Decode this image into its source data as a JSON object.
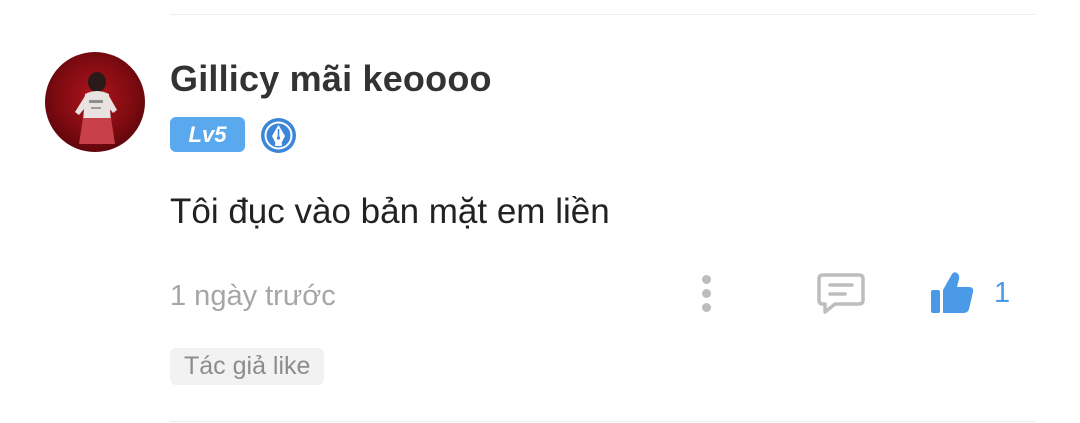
{
  "comment": {
    "username": "Gillicy mãi keoooo",
    "level": "Lv5",
    "text": "Tôi đục vào bản mặt em liền",
    "timestamp": "1 ngày trước",
    "like_count": "1",
    "author_liked_label": "Tác giả like"
  },
  "icons": {
    "avatar": "user-avatar",
    "level_badge": "level-badge",
    "creator_badge": "pen-nib-badge-icon",
    "more": "more-vertical-icon",
    "reply": "comment-icon",
    "like": "thumbs-up-icon"
  },
  "colors": {
    "accent": "#4a9ae8",
    "level_badge_bg": "#5aa8ee",
    "username": "#333333",
    "text": "#222222",
    "muted": "#a6a6a6",
    "icon_gray": "#bdbdbd",
    "tag_bg": "#f2f2f2"
  }
}
